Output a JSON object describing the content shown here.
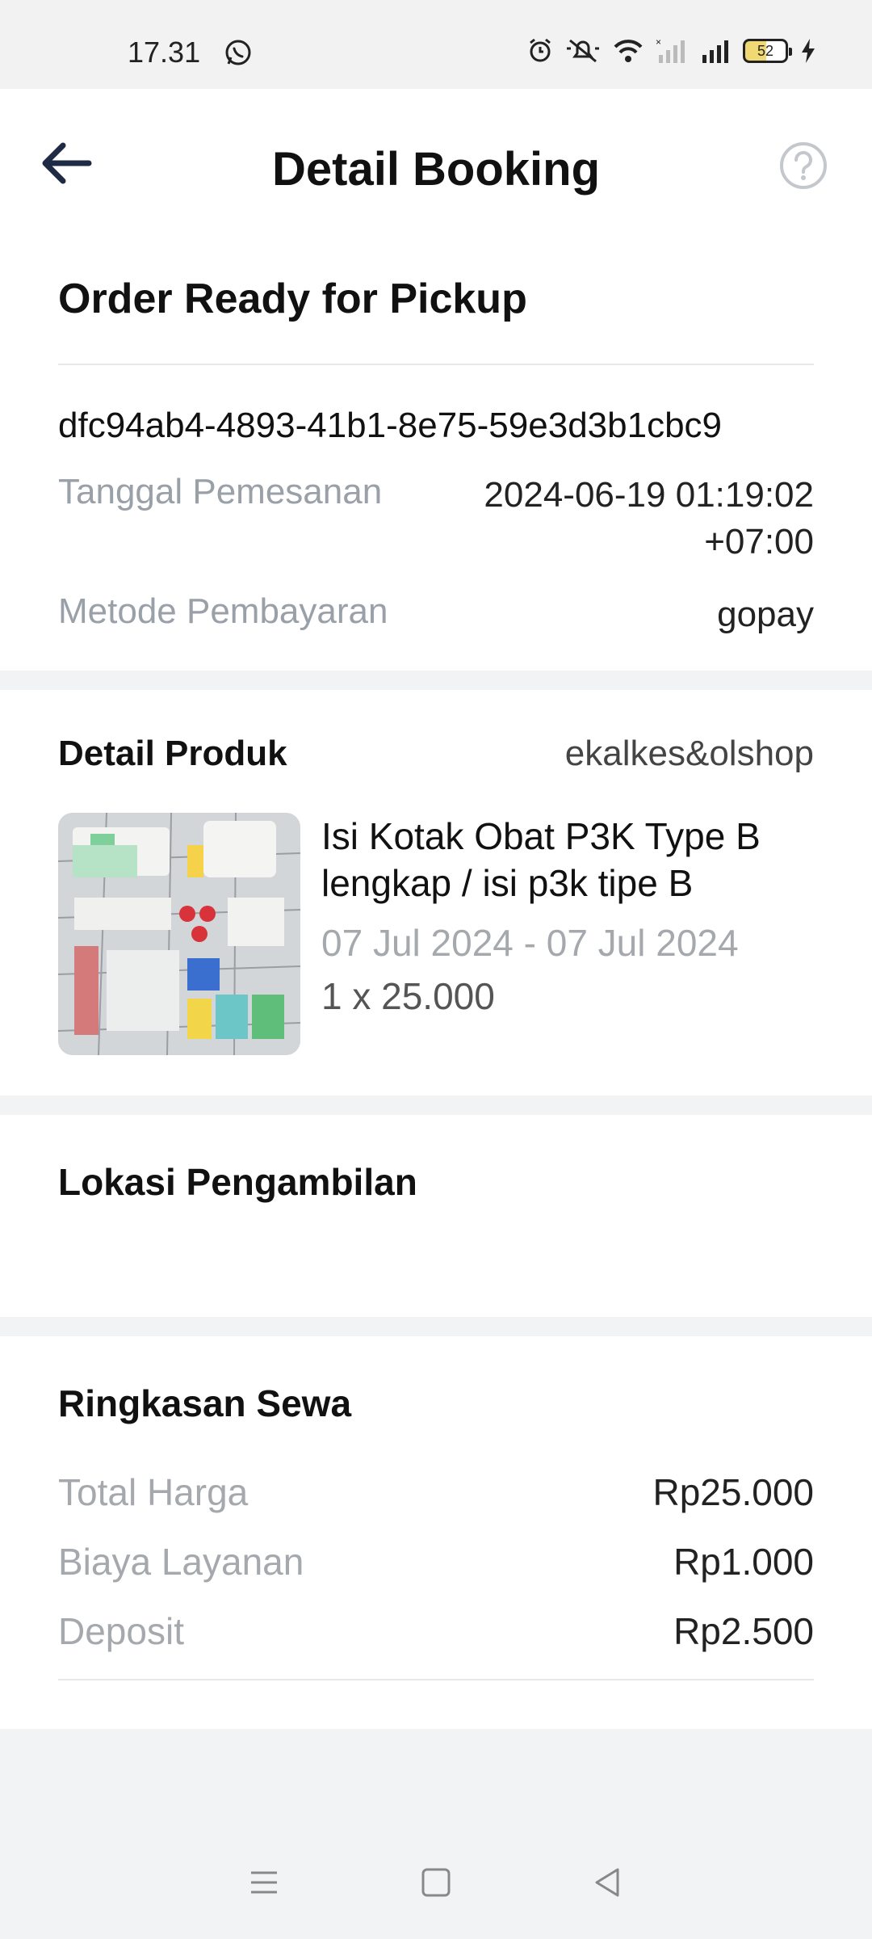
{
  "status_bar": {
    "time": "17.31",
    "battery": "52",
    "icons": [
      "whatsapp-icon",
      "alarm-icon",
      "mute-icon",
      "wifi-icon",
      "signal-icon",
      "battery-icon",
      "charging-icon"
    ]
  },
  "header": {
    "title": "Detail Booking",
    "back_icon": "arrow-left-icon",
    "help_icon": "question-circle-icon"
  },
  "order": {
    "status": "Order Ready for Pickup",
    "id": "dfc94ab4-4893-41b1-8e75-59e3d3b1cbc9",
    "date_label": "Tanggal Pemesanan",
    "date_value_line1": "2024-06-19 01:19:02",
    "date_value_line2": "+07:00",
    "payment_label": "Metode Pembayaran",
    "payment_value": "gopay"
  },
  "product": {
    "section_title": "Detail Produk",
    "shop": "ekalkes&olshop",
    "name_line1": "Isi Kotak Obat P3K Type B",
    "name_line2": "lengkap / isi p3k tipe B",
    "dates": "07 Jul 2024 - 07 Jul 2024",
    "qty": "1 x 25.000"
  },
  "pickup": {
    "section_title": "Lokasi Pengambilan"
  },
  "summary": {
    "section_title": "Ringkasan Sewa",
    "rows": [
      {
        "label": "Total Harga",
        "value": "Rp25.000"
      },
      {
        "label": "Biaya Layanan",
        "value": "Rp1.000"
      },
      {
        "label": "Deposit",
        "value": "Rp2.500"
      }
    ]
  },
  "nav": {
    "icons": [
      "menu-icon",
      "home-square-icon",
      "back-triangle-icon"
    ]
  },
  "colors": {
    "muted_text": "#9aa0a8",
    "divider": "#e8e8ea",
    "background": "#f2f3f5",
    "back_arrow": "#1f2a44"
  }
}
